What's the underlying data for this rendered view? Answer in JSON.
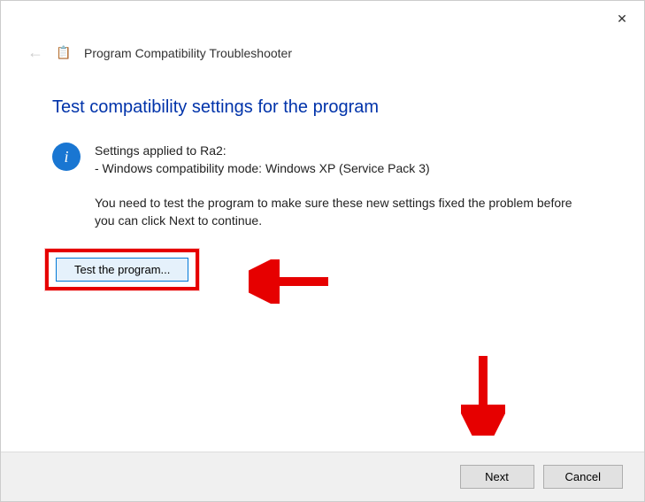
{
  "window": {
    "close_icon": "✕",
    "back_icon": "←",
    "app_icon": "📋",
    "title": "Program Compatibility Troubleshooter"
  },
  "heading": "Test compatibility settings for the program",
  "info": {
    "icon_letter": "i",
    "settings_line": "Settings applied to Ra2:",
    "mode_line": "- Windows compatibility mode: Windows XP (Service Pack 3)",
    "instruction": "You need to test the program to make sure these new settings fixed the problem before you can click Next to continue."
  },
  "buttons": {
    "test": "Test the program...",
    "next": "Next",
    "cancel": "Cancel"
  }
}
